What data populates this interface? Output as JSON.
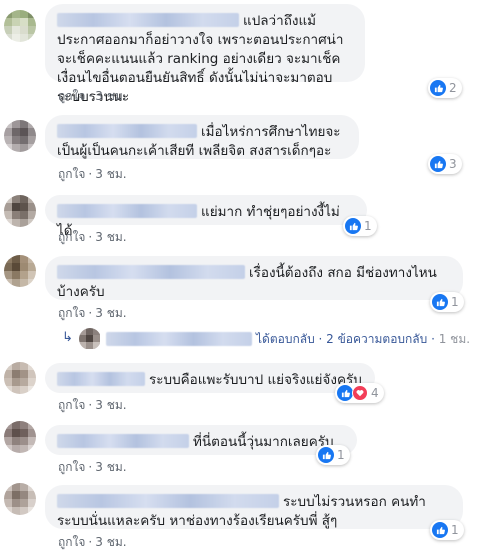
{
  "comments": [
    {
      "text": "แปลว่าถึงแม้ประกาศออกมาก็อย่าวางใจ เพราะตอนประกาศน่าจะเช็คคะแนนแล้ว ranking อย่างเดียว จะมาเช็คเงื่อนไขอื่นตอนยืนยันสิทธิ์ ดังนั้นไม่น่าจะมาตอบระบบรวนนะ",
      "like_label": "ถูกใจ",
      "time": "3 ชม.",
      "reaction_count": "2"
    },
    {
      "text": "เมื่อไหร่การศึกษาไทยจะเป็นผู้เป็นคนกะเค้าเสียที เพลียจิต สงสารเด็กๆอะ",
      "like_label": "ถูกใจ",
      "time": "3 ชม.",
      "reaction_count": "3"
    },
    {
      "text": "แย่มาก ทำชุ่ยๆอย่างงี้ไม่ได้",
      "like_label": "ถูกใจ",
      "time": "3 ชม.",
      "reaction_count": "1"
    },
    {
      "text": "เรื่องนี้ต้องถึง สกอ มีช่องทางไหนบ้างครับ",
      "like_label": "ถูกใจ",
      "time": "3 ชม.",
      "reaction_count": "1"
    },
    {
      "text": "ระบบคือแพะรับบาป แย่จริงแย่จังครับ",
      "like_label": "ถูกใจ",
      "time": "3 ชม.",
      "reaction_count": "4"
    },
    {
      "text": "ที่นี่ตอนนี้วุ่นมากเลยครับ",
      "like_label": "ถูกใจ",
      "time": "3 ชม.",
      "reaction_count": "1"
    },
    {
      "text": "ระบบไม่รวนหรอก คนทำระบบนั่นแหละครับ หาช่องทางร้องเรียนครับพี่ สู้ๆ",
      "like_label": "ถูกใจ",
      "time": "3 ชม.",
      "reaction_count": "1"
    }
  ],
  "reply_summary": {
    "text": "ได้ตอบกลับ · 2 ข้อความตอบกลับ ·",
    "time": "1 ชม."
  },
  "colors": {
    "bubble": "#f2f3f5",
    "link": "#385898",
    "like_blue": "#1877f2",
    "love_red": "#f33e58",
    "meta_gray": "#606770"
  },
  "icons": {
    "like": "thumbs-up-icon",
    "love": "heart-icon",
    "reply_arrow": "reply-arrow-icon"
  }
}
